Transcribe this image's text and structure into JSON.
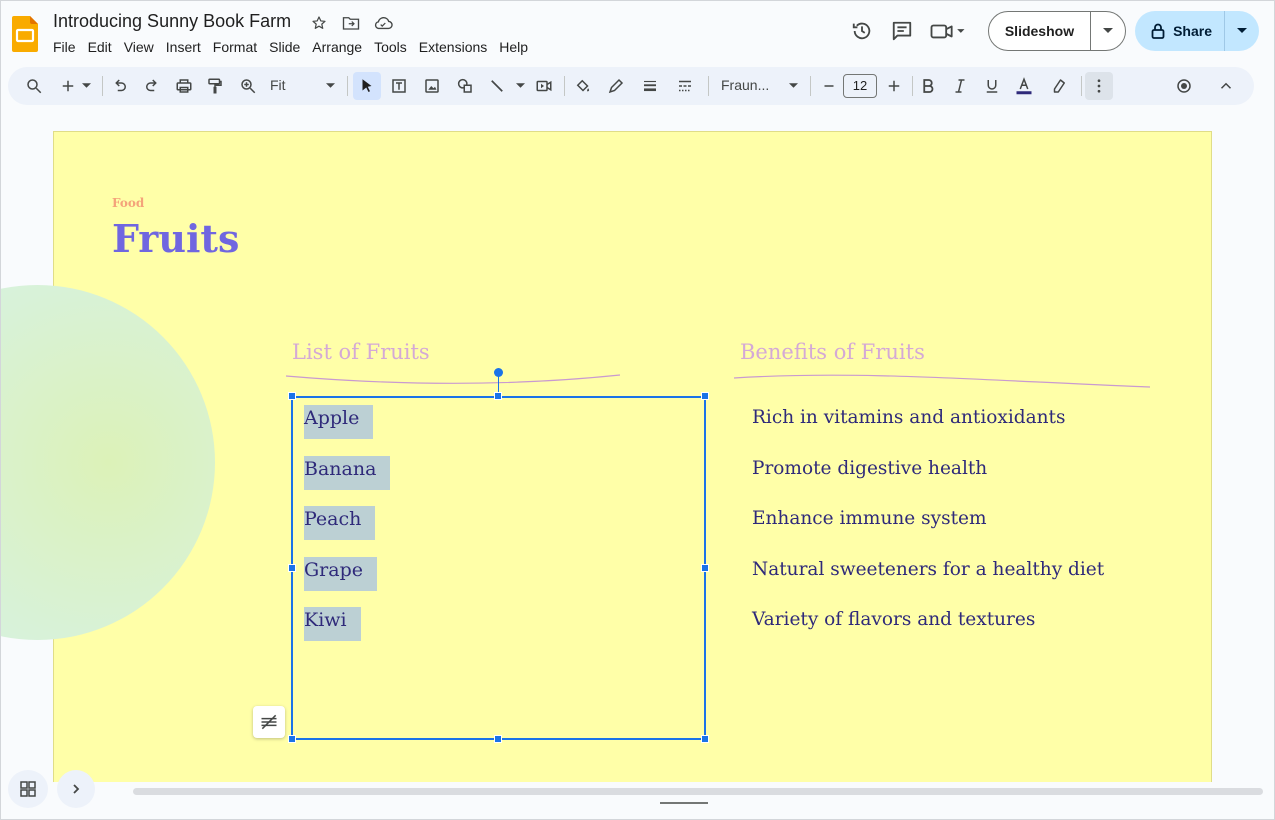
{
  "app": {
    "doc_title": "Introducing Sunny Book Farm",
    "menu": [
      "File",
      "Edit",
      "View",
      "Insert",
      "Format",
      "Slide",
      "Arrange",
      "Tools",
      "Extensions",
      "Help"
    ],
    "slideshow_label": "Slideshow",
    "share_label": "Share"
  },
  "toolbar": {
    "zoom": "Fit",
    "font": "Fraun...",
    "font_size": "12"
  },
  "slide": {
    "kicker": "Food",
    "title": "Fruits",
    "list_heading": "List of Fruits",
    "benefits_heading": "Benefits of Fruits",
    "fruits": [
      "Apple",
      "Banana",
      "Peach",
      "Grape",
      "Kiwi"
    ],
    "benefits": [
      "Rich in vitamins and antioxidants",
      "Promote digestive health",
      "Enhance immune system",
      "Natural sweeteners for a healthy diet",
      "Variety of flavors and textures"
    ]
  },
  "colors": {
    "slide_bg": "#ffffa8",
    "title": "#7066e0",
    "kicker": "#f4a37a",
    "heading": "#d4a9d6",
    "body_text": "#2f2a7a",
    "selection": "#1a73e8",
    "share_bg": "#c2e7ff"
  }
}
